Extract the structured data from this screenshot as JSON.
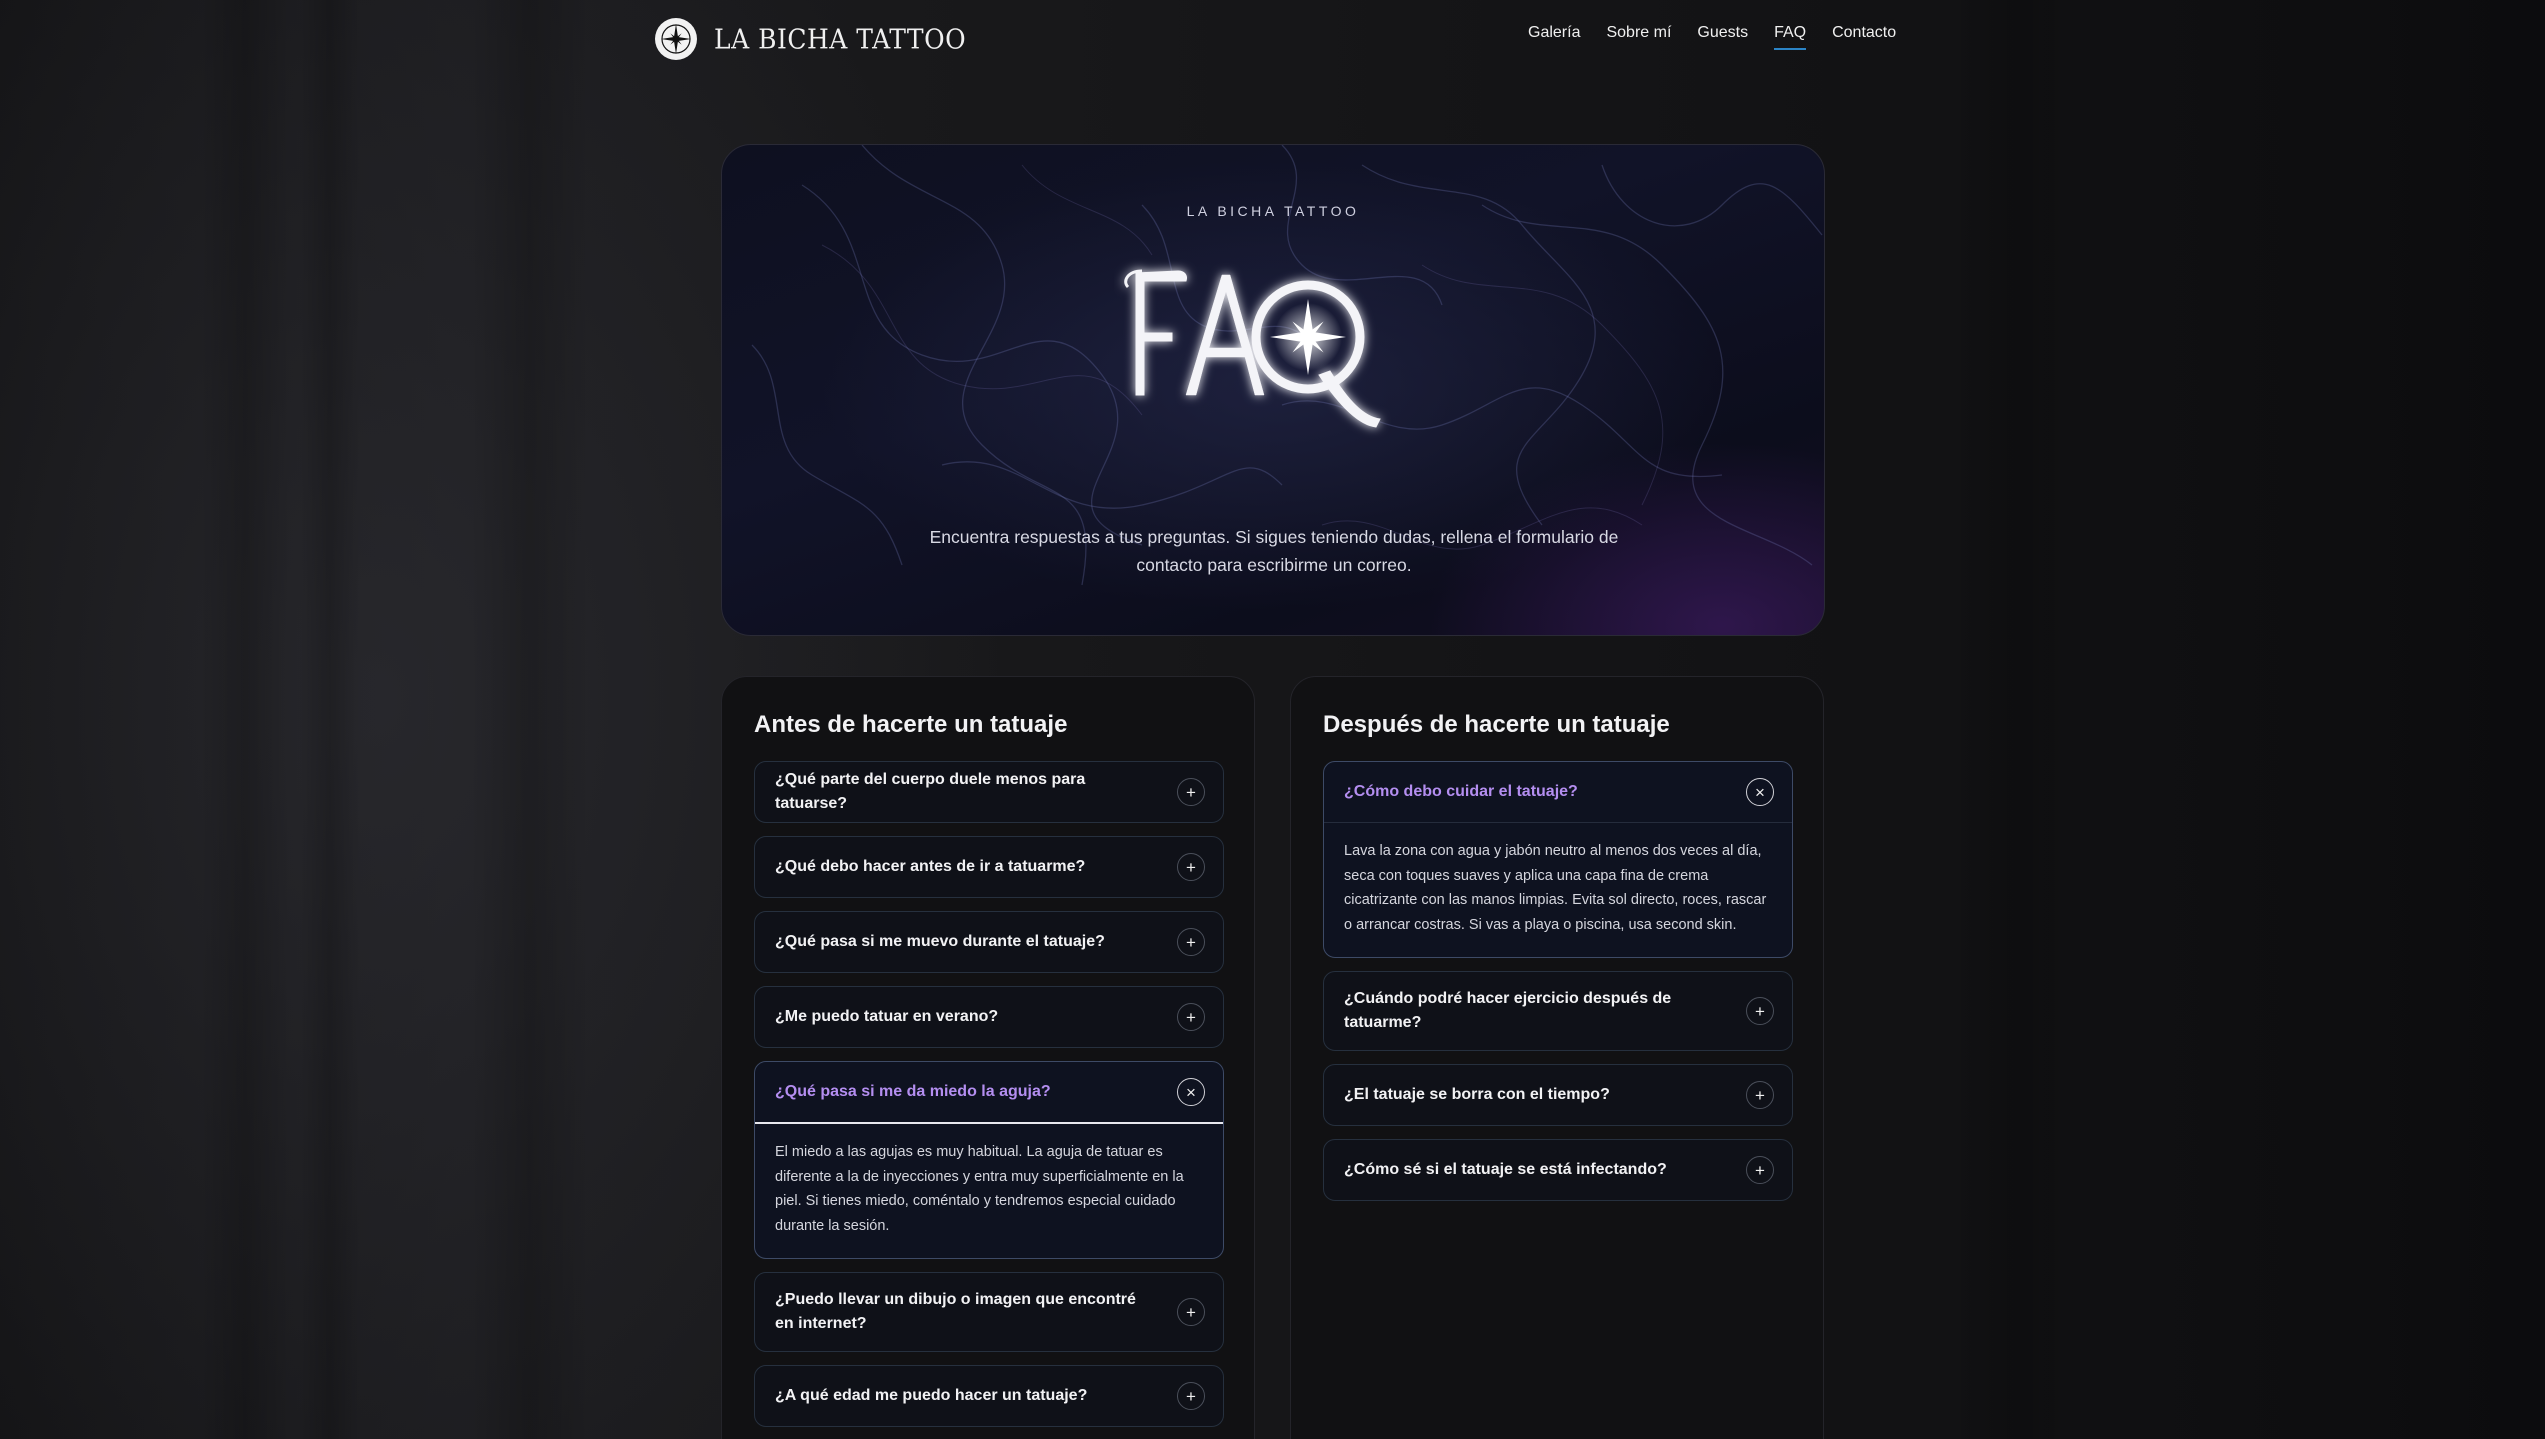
{
  "brand": {
    "name": "LA BICHA TATTOO",
    "logo_icon": "compass-star-icon"
  },
  "nav": {
    "links": [
      {
        "label": "Galería"
      },
      {
        "label": "Sobre mí"
      },
      {
        "label": "Guests"
      },
      {
        "label": "FAQ",
        "active": true
      },
      {
        "label": "Contacto"
      }
    ]
  },
  "hero": {
    "eyebrow": "LA BICHA TATTOO",
    "title": "FAQ",
    "description": "Encuentra respuestas a tus preguntas. Si sigues teniendo dudas, rellena el formulario de contacto para escribirme un correo."
  },
  "before": {
    "title": "Antes de hacerte un tatuaje",
    "items": [
      {
        "q": "¿Qué parte del cuerpo duele menos para tatuarse?",
        "toggle": "+"
      },
      {
        "q": "¿Qué debo hacer antes de ir a tatuarme?",
        "toggle": "+"
      },
      {
        "q": "¿Qué pasa si me muevo durante el tatuaje?",
        "toggle": "+"
      },
      {
        "q": "¿Me puedo tatuar en verano?",
        "toggle": "+"
      },
      {
        "q": "¿Qué pasa si me da miedo la aguja?",
        "toggle": "×",
        "a": "El miedo a las agujas es muy habitual. La aguja de tatuar es diferente a la de inyecciones y entra muy superficialmente en la piel. Si tienes miedo, coméntalo y tendremos especial cuidado durante la sesión."
      },
      {
        "q": "¿Puedo llevar un dibujo o imagen que encontré en internet?",
        "toggle": "+"
      },
      {
        "q": "¿A qué edad me puedo hacer un tatuaje?",
        "toggle": "+"
      }
    ]
  },
  "after": {
    "title": "Después de hacerte un tatuaje",
    "items": [
      {
        "q": "¿Cómo debo cuidar el tatuaje?",
        "toggle": "×",
        "a": "Lava la zona con agua y jabón neutro al menos dos veces al día, seca con toques suaves y aplica una capa fina de crema cicatrizante con las manos limpias. Evita sol directo, roces, rascar o arrancar costras. Si vas a playa o piscina, usa second skin."
      },
      {
        "q": "¿Cuándo podré hacer ejercicio después de tatuarme?",
        "toggle": "+"
      },
      {
        "q": "¿El tatuaje se borra con el tiempo?",
        "toggle": "+"
      },
      {
        "q": "¿Cómo sé si el tatuaje se está infectando?",
        "toggle": "+"
      }
    ]
  },
  "colors": {
    "accent_link_underline": "#2b84c6",
    "open_question": "#b48ef0",
    "background": "#121214"
  }
}
